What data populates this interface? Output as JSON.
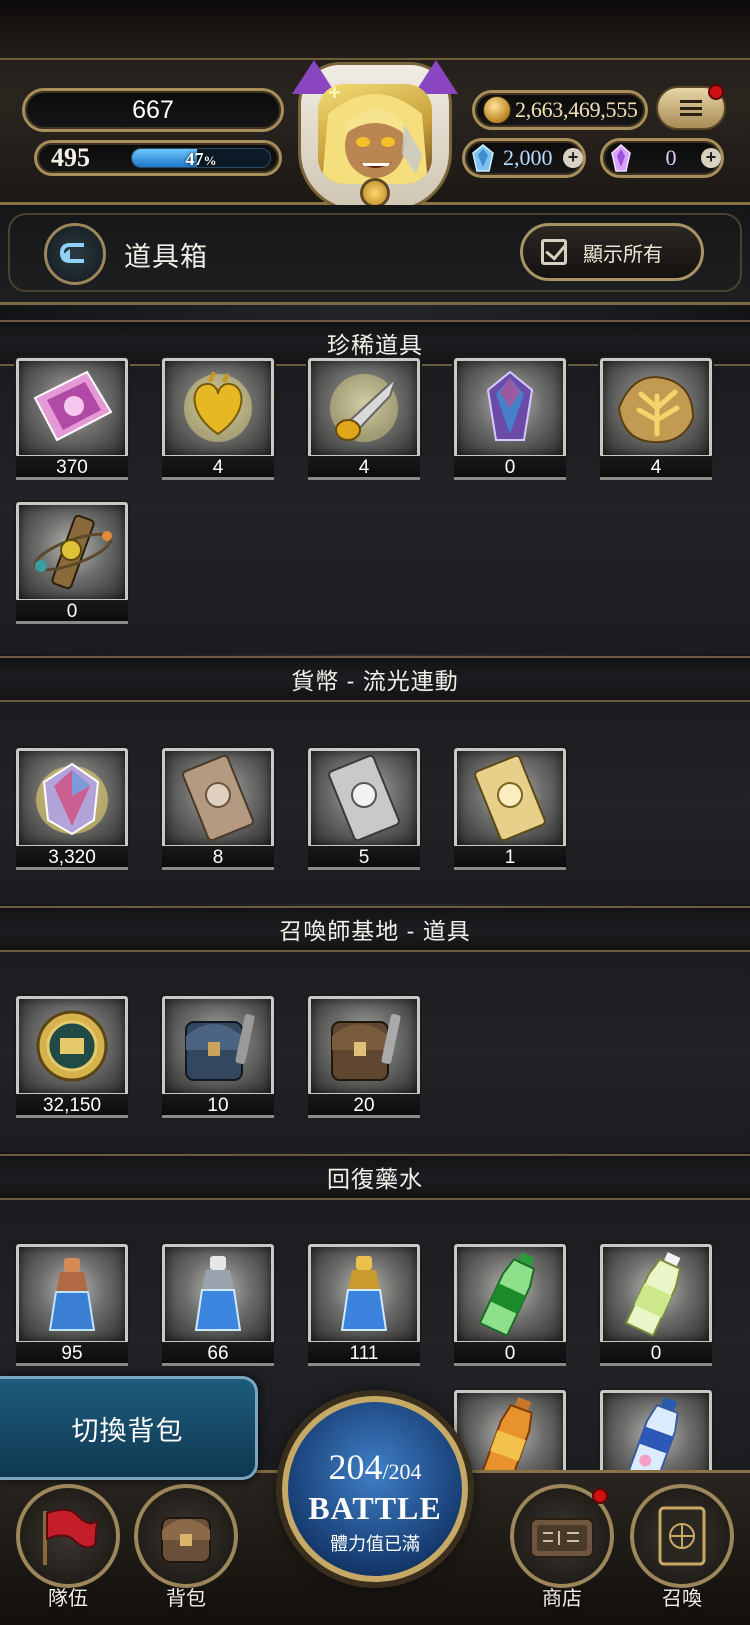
{
  "header": {
    "score": "667",
    "level": "495",
    "exp_percent": 47,
    "exp_text": "47",
    "exp_unit": "%",
    "gold": "2,663,469,555",
    "blue_gems": "2,000",
    "purple_gems": "0"
  },
  "titlebar": {
    "title": "道具箱",
    "show_all_label": "顯示所有"
  },
  "sections": [
    {
      "title": "珍稀道具",
      "items": [
        {
          "icon": "pink-card-icon",
          "count": "370"
        },
        {
          "icon": "golden-heart-icon",
          "count": "4"
        },
        {
          "icon": "golden-horn-icon",
          "count": "4"
        },
        {
          "icon": "crystal-icon",
          "count": "0"
        },
        {
          "icon": "leaf-bag-icon",
          "count": "4"
        },
        {
          "icon": "orbit-device-icon",
          "count": "0"
        }
      ]
    },
    {
      "title": "貨幣 - 流光連動",
      "items": [
        {
          "icon": "prism-gem-icon",
          "count": "3,320"
        },
        {
          "icon": "bronze-ticket-icon",
          "count": "8"
        },
        {
          "icon": "silver-ticket-icon",
          "count": "5"
        },
        {
          "icon": "gold-ticket-icon",
          "count": "1"
        }
      ]
    },
    {
      "title": "召喚師基地 - 道具",
      "items": [
        {
          "icon": "base-medal-icon",
          "count": "32,150"
        },
        {
          "icon": "blue-backpack-icon",
          "count": "10"
        },
        {
          "icon": "brown-backpack-icon",
          "count": "20"
        }
      ]
    },
    {
      "title": "回復藥水",
      "items": [
        {
          "icon": "small-potion-icon",
          "count": "95"
        },
        {
          "icon": "medium-potion-icon",
          "count": "66"
        },
        {
          "icon": "large-potion-icon",
          "count": "111"
        },
        {
          "icon": "green-bottle-icon",
          "count": "0"
        },
        {
          "icon": "white-bottle-icon",
          "count": "0"
        },
        {
          "icon": "tea-bottle-icon",
          "count": ""
        },
        {
          "icon": "water-bottle-icon",
          "count": ""
        }
      ]
    }
  ],
  "bottom": {
    "switch_bag": "切換背包",
    "battle": {
      "current": "204",
      "max": "/204",
      "label": "BATTLE",
      "sub": "體力值已滿"
    },
    "nav": [
      {
        "label": "隊伍",
        "icon": "flag-icon"
      },
      {
        "label": "背包",
        "icon": "backpack-icon"
      },
      {
        "label": "商店",
        "icon": "shop-sign-icon"
      },
      {
        "label": "召喚",
        "icon": "summon-card-icon"
      }
    ]
  }
}
